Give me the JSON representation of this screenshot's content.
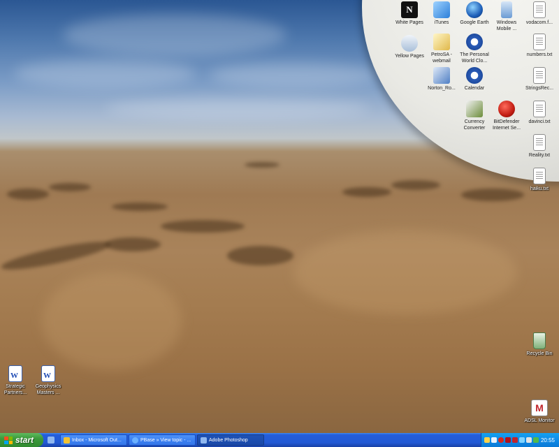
{
  "desktop": {
    "icons_top": [
      {
        "label": "White Pages",
        "icon": "white-pages-icon"
      },
      {
        "label": "iTunes",
        "icon": "itunes-icon"
      },
      {
        "label": "Google Earth",
        "icon": "google-earth-icon"
      },
      {
        "label": "Windows\nMobile ...",
        "icon": "windows-mobile-icon"
      },
      {
        "label": "vodacom.f...",
        "icon": "text-file-icon"
      },
      {
        "label": "Yellow Pages",
        "icon": "yellow-pages-icon"
      },
      {
        "label": "PetroSA -\nwebmail",
        "icon": "webmail-icon"
      },
      {
        "label": "The Personal\nWorld Clo...",
        "icon": "world-clock-icon"
      },
      {
        "label": "numbers.txt",
        "icon": "text-file-icon"
      },
      {
        "label": "Norton_Ro...",
        "icon": "norton-icon"
      },
      {
        "label": "Calendar",
        "icon": "calendar-icon"
      },
      {
        "label": "StringsRec...",
        "icon": "text-file-icon"
      },
      {
        "label": "Currency\nConverter",
        "icon": "currency-converter-icon"
      },
      {
        "label": "BitDefender\nInternet Se...",
        "icon": "bitdefender-icon"
      },
      {
        "label": "davinci.txt",
        "icon": "text-file-icon"
      },
      {
        "label": "Reality.txt",
        "icon": "text-file-icon"
      },
      {
        "label": "haiku.txt",
        "icon": "text-file-icon"
      }
    ],
    "icons_bottom_left": [
      {
        "label": "Strategic\nPartners...",
        "icon": "word-document-icon"
      },
      {
        "label": "Geophysics\nMasters ...",
        "icon": "word-document-icon"
      }
    ],
    "recycle_bin": {
      "label": "Recycle Bin",
      "icon": "recycle-bin-icon"
    },
    "adsl_monitor": {
      "label": "ADSL Monitor",
      "icon": "adsl-monitor-icon"
    }
  },
  "taskbar": {
    "start_label": "start",
    "tasks": [
      {
        "label": "Inbox - Microsoft Out...",
        "icon": "outlook-icon",
        "active": false
      },
      {
        "label": "PBase » View topic - ...",
        "icon": "internet-explorer-icon",
        "active": false
      },
      {
        "label": "Adobe Photoshop",
        "icon": "photoshop-icon",
        "active": true
      }
    ],
    "clock": "20:55"
  },
  "colors": {
    "taskbar_blue": "#245edb",
    "start_green": "#3c9b3c",
    "tray_blue": "#0f8be6"
  }
}
